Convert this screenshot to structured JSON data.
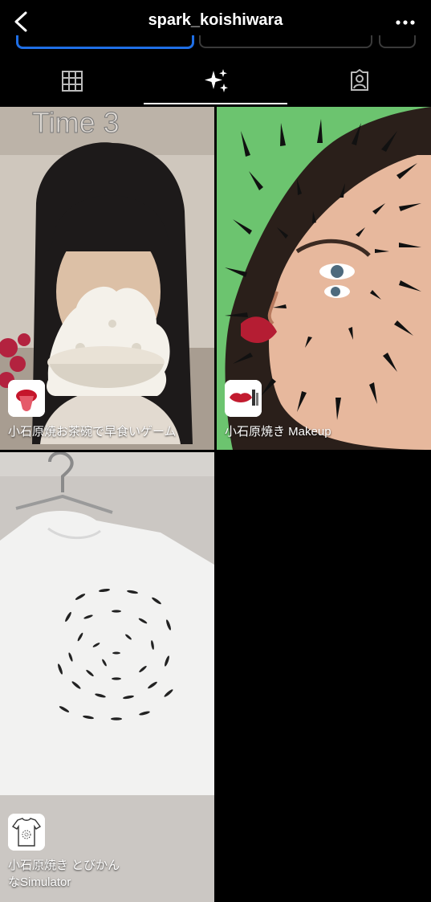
{
  "header": {
    "title": "spark_koishiwara"
  },
  "tabs": [
    {
      "name": "grid"
    },
    {
      "name": "effects"
    },
    {
      "name": "tagged"
    }
  ],
  "tiles": [
    {
      "label": "小石原焼お茶碗で早食いゲーム",
      "overlay_text": "Time 3"
    },
    {
      "label": "小石原焼き Makeup"
    },
    {
      "label_line1": "小石原焼き とびかん",
      "label_line2": "なSimulator"
    }
  ],
  "colors": {
    "accent": "#1f6fe6",
    "bg": "#000000"
  }
}
